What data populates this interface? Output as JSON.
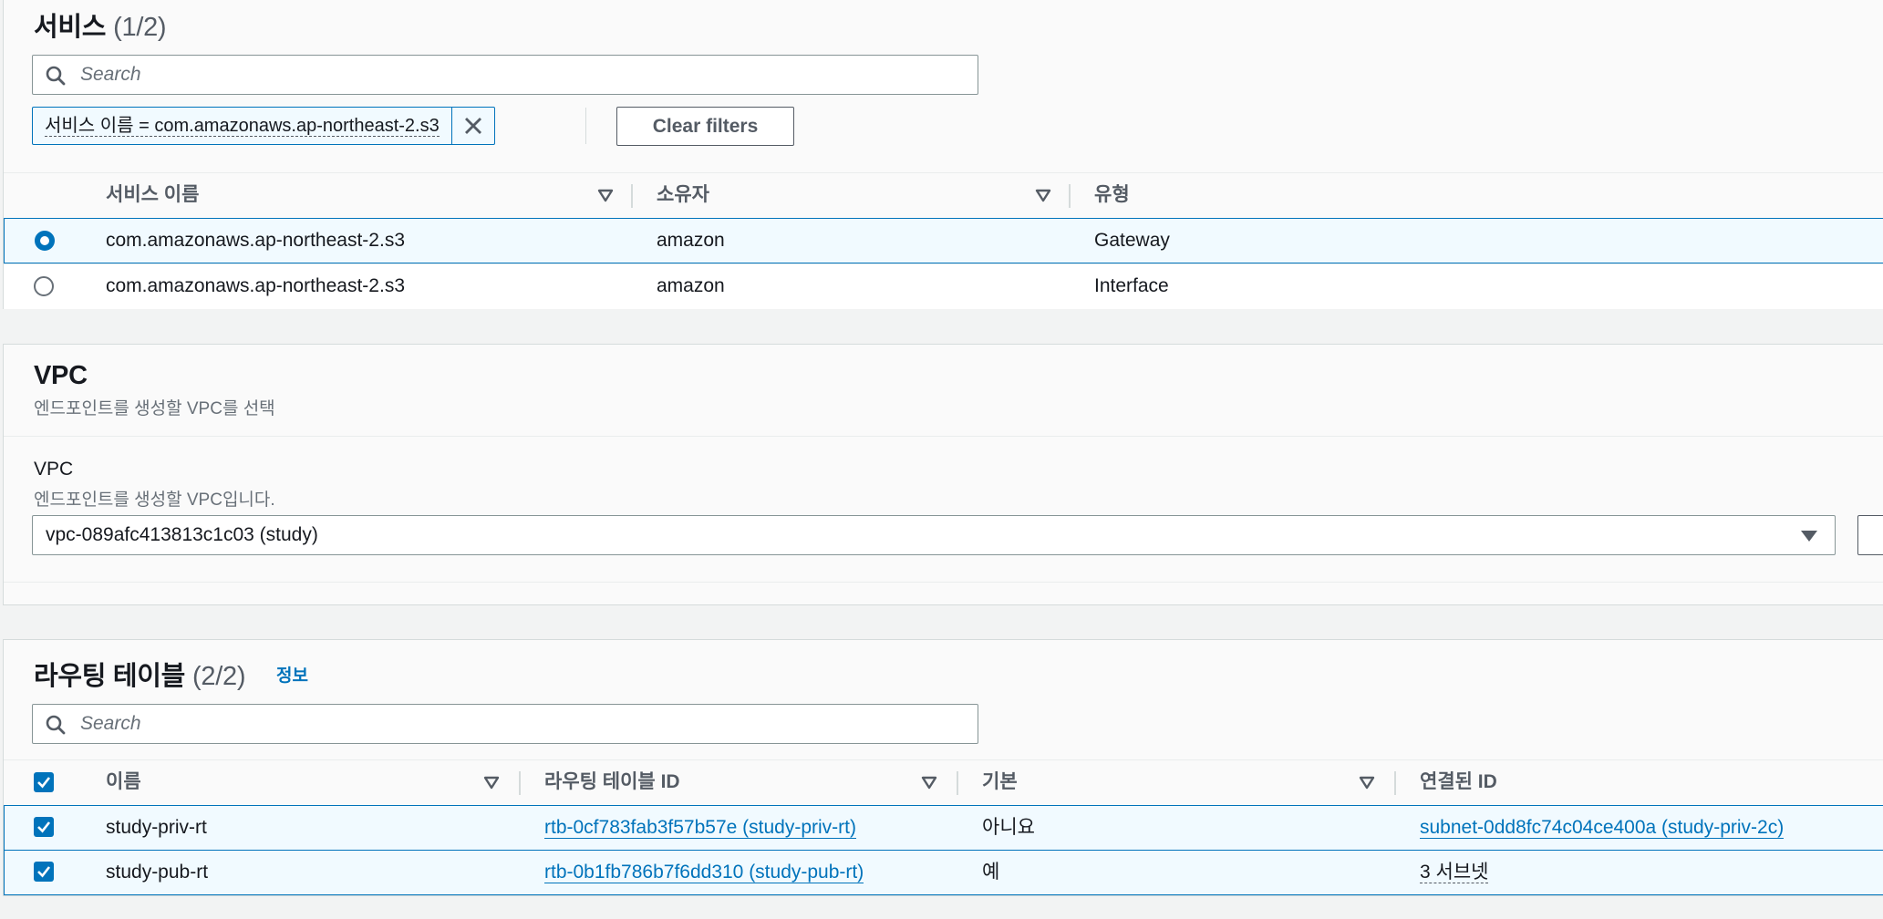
{
  "services": {
    "title": "서비스",
    "count": "(1/2)",
    "search_placeholder": "Search",
    "filter_token": "서비스 이름 = com.amazonaws.ap-northeast-2.s3",
    "clear_filters": "Clear filters",
    "columns": [
      "서비스 이름",
      "소유자",
      "유형"
    ],
    "rows": [
      {
        "selected": true,
        "name": "com.amazonaws.ap-northeast-2.s3",
        "owner": "amazon",
        "type": "Gateway"
      },
      {
        "selected": false,
        "name": "com.amazonaws.ap-northeast-2.s3",
        "owner": "amazon",
        "type": "Interface"
      }
    ]
  },
  "vpc": {
    "title": "VPC",
    "description": "엔드포인트를 생성할 VPC를 선택",
    "field_label": "VPC",
    "field_description": "엔드포인트를 생성할 VPC입니다.",
    "selected_value": "vpc-089afc413813c1c03 (study)"
  },
  "route_tables": {
    "title": "라우팅 테이블",
    "count": "(2/2)",
    "info": "정보",
    "search_placeholder": "Search",
    "columns": [
      "이름",
      "라우팅 테이블 ID",
      "기본",
      "연결된 ID"
    ],
    "rows": [
      {
        "checked": true,
        "name": "study-priv-rt",
        "id": "rtb-0cf783fab3f57b57e (study-priv-rt)",
        "default": "아니요",
        "associated": "subnet-0dd8fc74c04ce400a (study-priv-2c)"
      },
      {
        "checked": true,
        "name": "study-pub-rt",
        "id": "rtb-0b1fb786b7f6dd310 (study-pub-rt)",
        "default": "예",
        "associated": "3 서브넷"
      }
    ]
  },
  "colors": {
    "accent": "#0073bb",
    "selected_row_bg": "#f1faff",
    "border": "#d5dbdb"
  }
}
